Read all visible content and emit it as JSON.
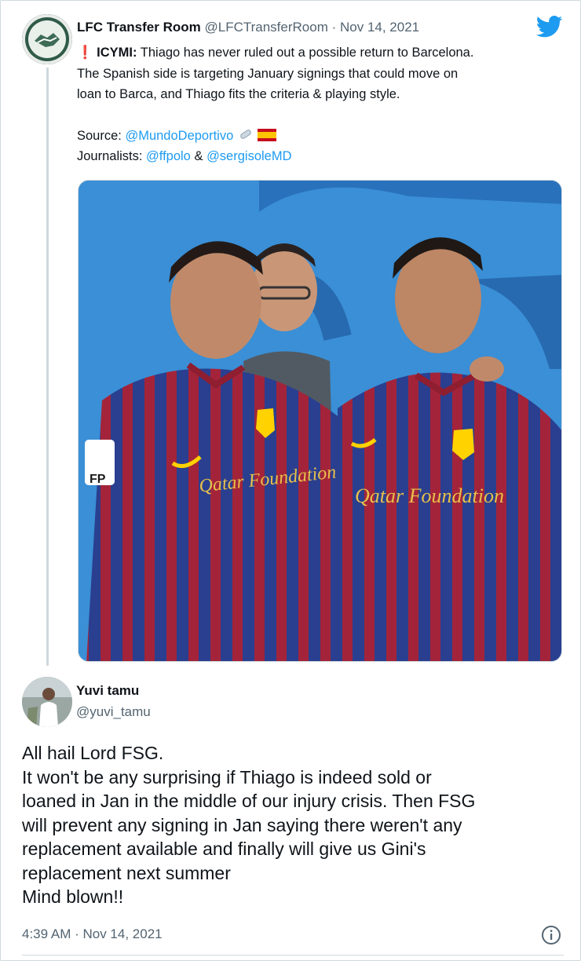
{
  "quoted_tweet": {
    "display_name": "LFC Transfer Room",
    "handle": "@LFCTransferRoom",
    "separator": " · ",
    "date": "Nov 14, 2021",
    "icymi": "ICYMI:",
    "line1_rest": " Thiago has never ruled out a possible return to Barcelona.",
    "line2": "The Spanish side is targeting January signings that could move on",
    "line3": "loan to Barca, and Thiago fits the criteria & playing style.",
    "source_label": "Source: ",
    "source_link": "@MundoDeportivo",
    "journalists_label": "Journalists: ",
    "journalist_1": "@ffpolo",
    "and_word": " & ",
    "journalist_2": "@sergisoleMD",
    "image_text_left": "Qatar Foundation",
    "image_text_right": "Qatar Foundation",
    "image_badge": "FP"
  },
  "reply_tweet": {
    "display_name": "Yuvi tamu",
    "handle": "@yuvi_tamu",
    "lines": [
      "All hail Lord FSG.",
      "It won't be any surprising if Thiago is indeed sold or",
      "loaned in Jan in the middle of our injury crisis. Then FSG",
      "will prevent any signing in Jan saying there weren't any",
      "replacement available and finally will give us Gini's",
      "replacement next summer",
      "Mind blown!!"
    ],
    "timestamp": "4:39 AM · Nov 14, 2021"
  },
  "icons": [
    "twitter-bird-icon",
    "exclamation-icon",
    "link-icon",
    "spain-flag-icon",
    "info-icon"
  ],
  "colors": {
    "link": "#1d9bf0",
    "secondary_text": "#536471",
    "primary_text": "#0f1419",
    "exclamation": "#e0245e",
    "divider": "#cfd9de"
  }
}
